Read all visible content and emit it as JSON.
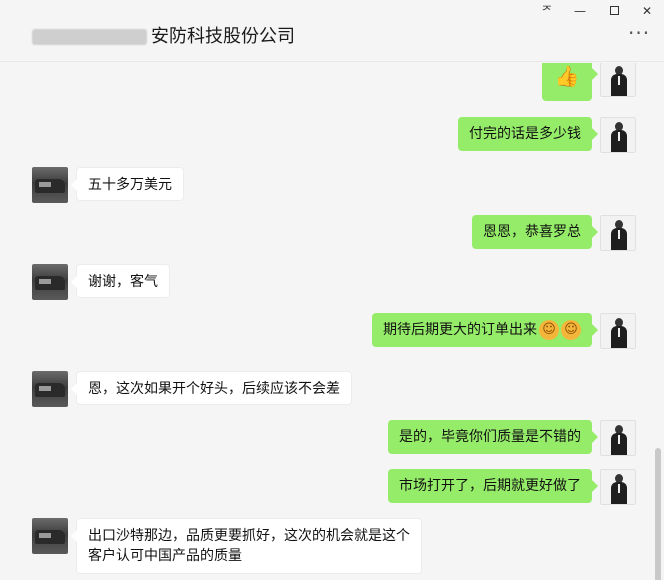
{
  "window": {
    "title_visible": "安防科技股份公司",
    "pin_glyph": "ᅎ",
    "minimize_glyph": "—",
    "close_glyph": "✕",
    "more_glyph": "···"
  },
  "messages": [
    {
      "side": "self",
      "type": "emoji",
      "icon": "thumbs-up-icon",
      "text": "👍"
    },
    {
      "side": "self",
      "text": "付完的话是多少钱"
    },
    {
      "side": "other",
      "text": "五十多万美元"
    },
    {
      "side": "self",
      "text": "恩恩，恭喜罗总"
    },
    {
      "side": "other",
      "text": "谢谢，客气"
    },
    {
      "side": "self",
      "text": "期待后期更大的订单出来"
    },
    {
      "side": "other",
      "text": "恩，这次如果开个好头，后续应该不会差"
    },
    {
      "side": "self",
      "text": "是的，毕竟你们质量是不错的"
    },
    {
      "side": "self",
      "text": "市场打开了，后期就更好做了"
    },
    {
      "side": "other",
      "line1": "出口沙特那边，品质更要抓好，这次的机会就是这个",
      "line2": "客户认可中国产品的质量"
    }
  ],
  "colors": {
    "self_bubble": "#95ec69",
    "other_bubble": "#ffffff",
    "background": "#f5f5f5"
  }
}
